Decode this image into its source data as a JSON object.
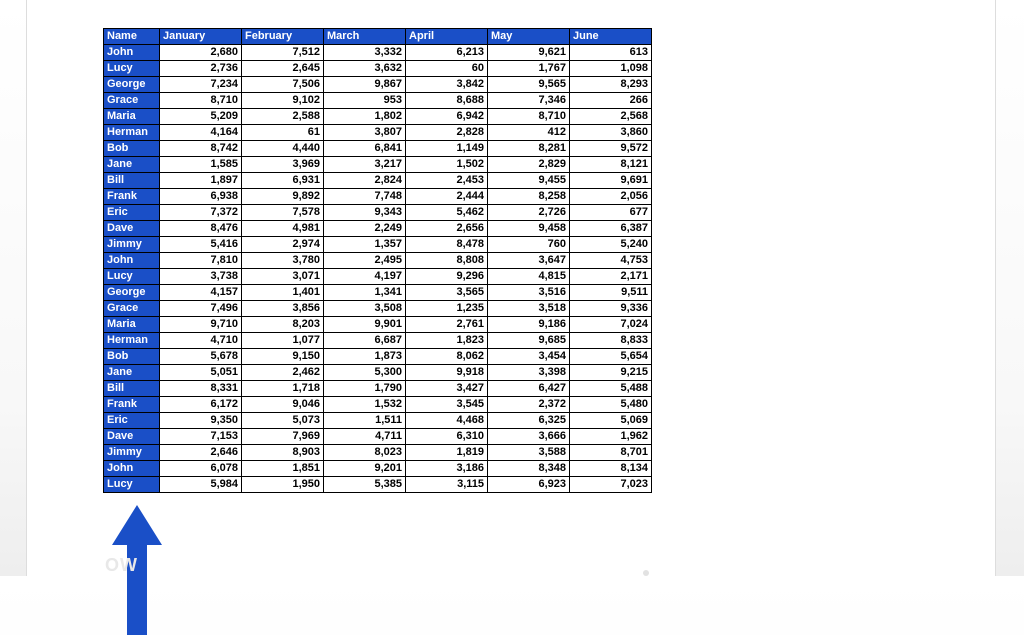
{
  "table": {
    "headers": [
      "Name",
      "January",
      "February",
      "March",
      "April",
      "May",
      "June"
    ],
    "rows": [
      {
        "name": "John",
        "vals": [
          "2,680",
          "7,512",
          "3,332",
          "6,213",
          "9,621",
          "613"
        ]
      },
      {
        "name": "Lucy",
        "vals": [
          "2,736",
          "2,645",
          "3,632",
          "60",
          "1,767",
          "1,098"
        ]
      },
      {
        "name": "George",
        "vals": [
          "7,234",
          "7,506",
          "9,867",
          "3,842",
          "9,565",
          "8,293"
        ]
      },
      {
        "name": "Grace",
        "vals": [
          "8,710",
          "9,102",
          "953",
          "8,688",
          "7,346",
          "266"
        ]
      },
      {
        "name": "Maria",
        "vals": [
          "5,209",
          "2,588",
          "1,802",
          "6,942",
          "8,710",
          "2,568"
        ]
      },
      {
        "name": "Herman",
        "vals": [
          "4,164",
          "61",
          "3,807",
          "2,828",
          "412",
          "3,860"
        ]
      },
      {
        "name": "Bob",
        "vals": [
          "8,742",
          "4,440",
          "6,841",
          "1,149",
          "8,281",
          "9,572"
        ]
      },
      {
        "name": "Jane",
        "vals": [
          "1,585",
          "3,969",
          "3,217",
          "1,502",
          "2,829",
          "8,121"
        ]
      },
      {
        "name": "Bill",
        "vals": [
          "1,897",
          "6,931",
          "2,824",
          "2,453",
          "9,455",
          "9,691"
        ]
      },
      {
        "name": "Frank",
        "vals": [
          "6,938",
          "9,892",
          "7,748",
          "2,444",
          "8,258",
          "2,056"
        ]
      },
      {
        "name": "Eric",
        "vals": [
          "7,372",
          "7,578",
          "9,343",
          "5,462",
          "2,726",
          "677"
        ]
      },
      {
        "name": "Dave",
        "vals": [
          "8,476",
          "4,981",
          "2,249",
          "2,656",
          "9,458",
          "6,387"
        ]
      },
      {
        "name": "Jimmy",
        "vals": [
          "5,416",
          "2,974",
          "1,357",
          "8,478",
          "760",
          "5,240"
        ]
      },
      {
        "name": "John",
        "vals": [
          "7,810",
          "3,780",
          "2,495",
          "8,808",
          "3,647",
          "4,753"
        ]
      },
      {
        "name": "Lucy",
        "vals": [
          "3,738",
          "3,071",
          "4,197",
          "9,296",
          "4,815",
          "2,171"
        ]
      },
      {
        "name": "George",
        "vals": [
          "4,157",
          "1,401",
          "1,341",
          "3,565",
          "3,516",
          "9,511"
        ]
      },
      {
        "name": "Grace",
        "vals": [
          "7,496",
          "3,856",
          "3,508",
          "1,235",
          "3,518",
          "9,336"
        ]
      },
      {
        "name": "Maria",
        "vals": [
          "9,710",
          "8,203",
          "9,901",
          "2,761",
          "9,186",
          "7,024"
        ]
      },
      {
        "name": "Herman",
        "vals": [
          "4,710",
          "1,077",
          "6,687",
          "1,823",
          "9,685",
          "8,833"
        ]
      },
      {
        "name": "Bob",
        "vals": [
          "5,678",
          "9,150",
          "1,873",
          "8,062",
          "3,454",
          "5,654"
        ]
      },
      {
        "name": "Jane",
        "vals": [
          "5,051",
          "2,462",
          "5,300",
          "9,918",
          "3,398",
          "9,215"
        ]
      },
      {
        "name": "Bill",
        "vals": [
          "8,331",
          "1,718",
          "1,790",
          "3,427",
          "6,427",
          "5,488"
        ]
      },
      {
        "name": "Frank",
        "vals": [
          "6,172",
          "9,046",
          "1,532",
          "3,545",
          "2,372",
          "5,480"
        ]
      },
      {
        "name": "Eric",
        "vals": [
          "9,350",
          "5,073",
          "1,511",
          "4,468",
          "6,325",
          "5,069"
        ]
      },
      {
        "name": "Dave",
        "vals": [
          "7,153",
          "7,969",
          "4,711",
          "6,310",
          "3,666",
          "1,962"
        ]
      },
      {
        "name": "Jimmy",
        "vals": [
          "2,646",
          "8,903",
          "8,023",
          "1,819",
          "3,588",
          "8,701"
        ]
      },
      {
        "name": "John",
        "vals": [
          "6,078",
          "1,851",
          "9,201",
          "3,186",
          "8,348",
          "8,134"
        ]
      },
      {
        "name": "Lucy",
        "vals": [
          "5,984",
          "1,950",
          "5,385",
          "3,115",
          "6,923",
          "7,023"
        ]
      }
    ]
  },
  "arrow_color": "#1a4fc7",
  "watermark_text": "OW"
}
